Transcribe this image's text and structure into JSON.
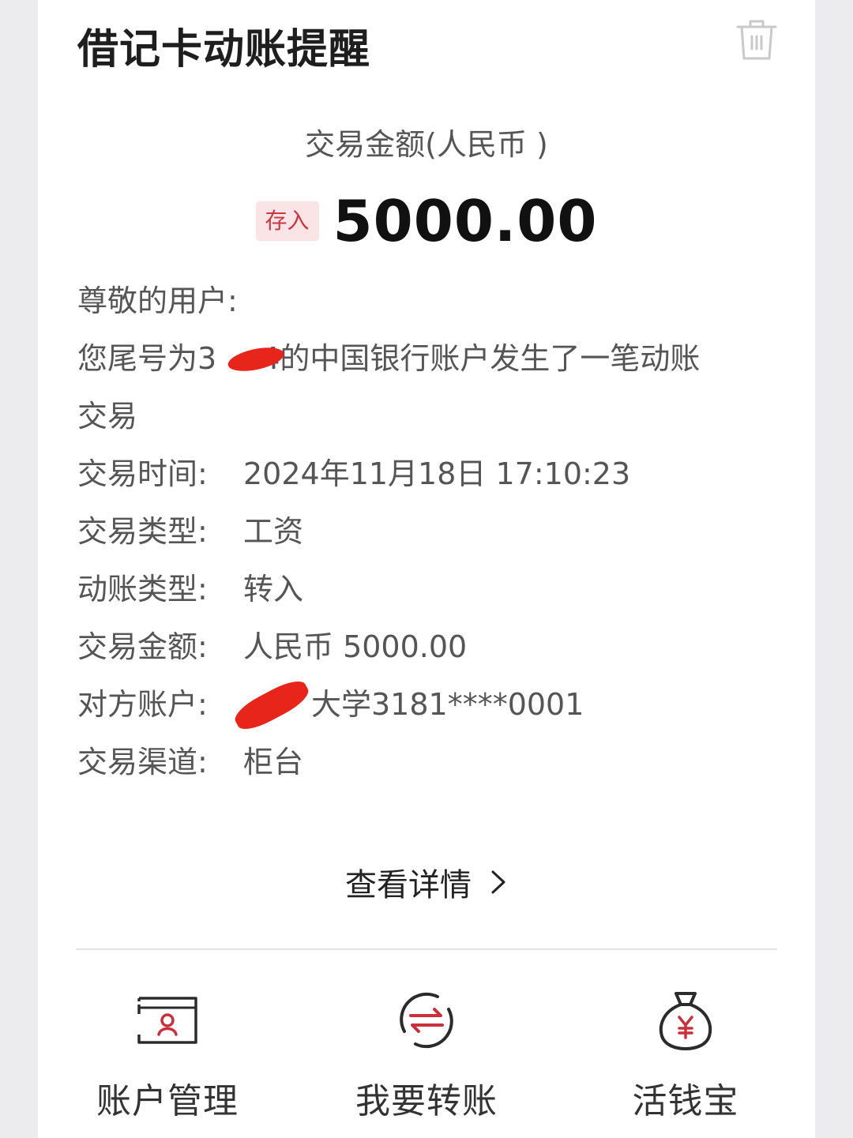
{
  "header": {
    "title": "借记卡动账提醒"
  },
  "amount_section": {
    "label": "交易金额(人民币 )",
    "badge": "存入",
    "amount": "5000.00"
  },
  "message": {
    "greeting": "尊敬的用户:",
    "line1_prefix": "您尾号为3",
    "line1_suffix": "4的中国银行账户发生了一笔动账",
    "line2": "交易",
    "fields": [
      {
        "key": "交易时间:",
        "value": "2024年11月18日 17:10:23"
      },
      {
        "key": "交易类型:",
        "value": "工资"
      },
      {
        "key": "动账类型:",
        "value": "转入"
      },
      {
        "key": "交易金额:",
        "value": "人民币 5000.00"
      },
      {
        "key": "对方账户:",
        "value": "大学3181****0001"
      },
      {
        "key": "交易渠道:",
        "value": "柜台"
      }
    ]
  },
  "detail_button": {
    "label": "查看详情"
  },
  "actions": [
    {
      "label": "账户管理",
      "icon": "account-card-icon"
    },
    {
      "label": "我要转账",
      "icon": "transfer-icon"
    },
    {
      "label": "活钱宝",
      "icon": "money-bag-icon"
    }
  ],
  "colors": {
    "accent_red": "#c8303c",
    "badge_bg": "#fbe4e6",
    "redaction": "#e8251a"
  }
}
